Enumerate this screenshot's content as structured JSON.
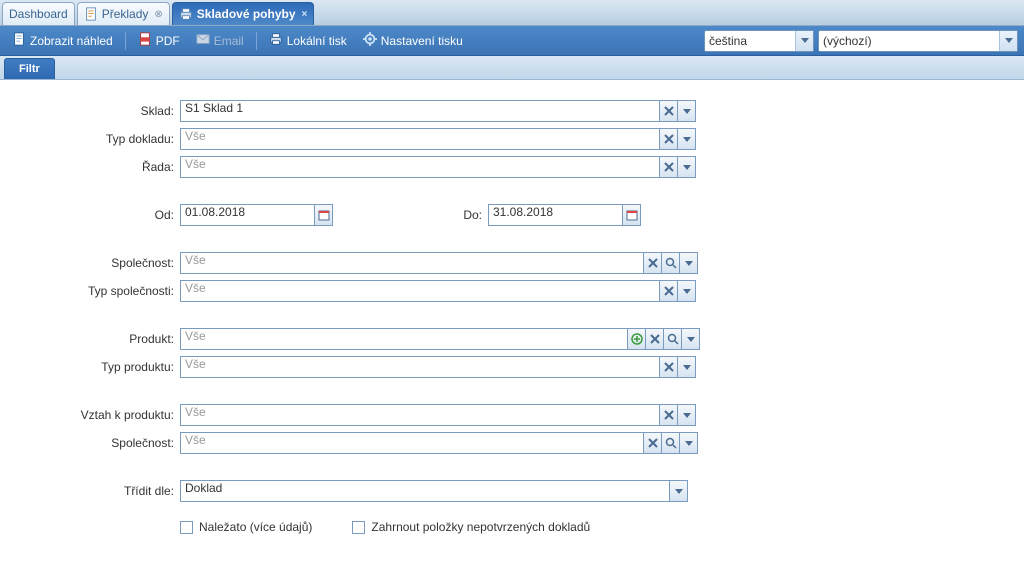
{
  "tabs": {
    "dashboard": {
      "label": "Dashboard"
    },
    "preklady": {
      "label": "Překlady"
    },
    "skladpohyby": {
      "label": "Skladové pohyby"
    }
  },
  "toolbar": {
    "preview": "Zobrazit náhled",
    "pdf": "PDF",
    "email": "Email",
    "localprint": "Lokální tisk",
    "printsettings": "Nastavení tisku",
    "language": "čeština",
    "profile": "(výchozí)"
  },
  "subtab": {
    "filter": "Filtr"
  },
  "form": {
    "sklad_label": "Sklad:",
    "sklad_value": "S1 Sklad 1",
    "typdokladu_label": "Typ dokladu:",
    "typdokladu_value": "Vše",
    "rada_label": "Řada:",
    "rada_value": "Vše",
    "od_label": "Od:",
    "od_value": "01.08.2018",
    "do_label": "Do:",
    "do_value": "31.08.2018",
    "spolecnost_label": "Společnost:",
    "spolecnost_value": "Vše",
    "typspolecnosti_label": "Typ společnosti:",
    "typspolecnosti_value": "Vše",
    "produkt_label": "Produkt:",
    "produkt_value": "Vše",
    "typproduktu_label": "Typ produktu:",
    "typproduktu_value": "Vše",
    "vztah_label": "Vztah k produktu:",
    "vztah_value": "Vše",
    "spolecnost2_label": "Společnost:",
    "spolecnost2_value": "Vše",
    "tridit_label": "Třídit dle:",
    "tridit_value": "Doklad",
    "chk_nalezato": "Naležato (více údajů)",
    "chk_zahrnout": "Zahrnout položky nepotvrzených dokladů"
  },
  "icons": {
    "doc": "doc-icon",
    "printer": "printer-icon",
    "pdf": "pdf-icon",
    "mail": "mail-icon",
    "gear": "gear-icon",
    "close_x": "×"
  }
}
